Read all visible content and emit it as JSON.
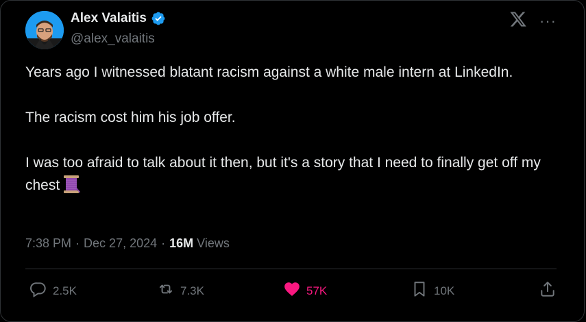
{
  "author": {
    "display_name": "Alex Valaitis",
    "handle": "@alex_valaitis",
    "verified_icon": "verified-badge-icon"
  },
  "header": {
    "logo_icon": "x-logo-icon",
    "more_label": "···"
  },
  "tweet": {
    "paragraphs": [
      "Years ago I witnessed blatant racism against a white male intern at LinkedIn.",
      "The racism cost him his job offer.",
      "I was too afraid to talk about it then, but it's a story that I need to finally get off my chest"
    ],
    "emoji": "thread-spool-icon"
  },
  "meta": {
    "time": "7:38 PM",
    "date": "Dec 27, 2024",
    "views_count": "16M",
    "views_label": "Views",
    "separator": "·"
  },
  "actions": {
    "replies": "2.5K",
    "reposts": "7.3K",
    "likes": "57K",
    "bookmarks": "10K"
  },
  "colors": {
    "background": "#000000",
    "text": "#e7e9ea",
    "muted": "#71767b",
    "like": "#f91880",
    "verified": "#1d9bf0",
    "divider": "#2f3336"
  }
}
